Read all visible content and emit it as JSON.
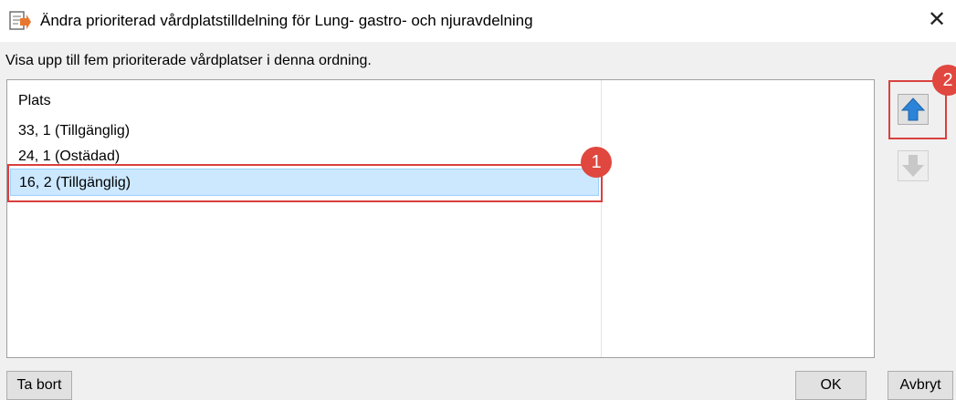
{
  "window": {
    "title": "Ändra prioriterad vårdplatstilldelning för Lung- gastro- och njuravdelning",
    "close_glyph": "✕"
  },
  "instruction": "Visa upp till fem prioriterade vårdplatser i denna ordning.",
  "list": {
    "column_header": "Plats",
    "rows": [
      {
        "label": "33, 1 (Tillgänglig)",
        "selected": false
      },
      {
        "label": "24, 1 (Ostädad)",
        "selected": false
      },
      {
        "label": "16, 2 (Tillgänglig)",
        "selected": true
      }
    ]
  },
  "side_buttons": {
    "up_icon": "arrow-up-icon",
    "down_icon": "arrow-down-icon",
    "up_enabled": true,
    "down_enabled": false
  },
  "annotations": {
    "badge1": "1",
    "badge2": "2"
  },
  "buttons": {
    "remove": "Ta bort",
    "ok": "OK",
    "cancel": "Avbryt"
  },
  "colors": {
    "annotation_red": "#d9403e",
    "selection": "#cce8ff",
    "arrow_blue": "#2b84d8"
  }
}
